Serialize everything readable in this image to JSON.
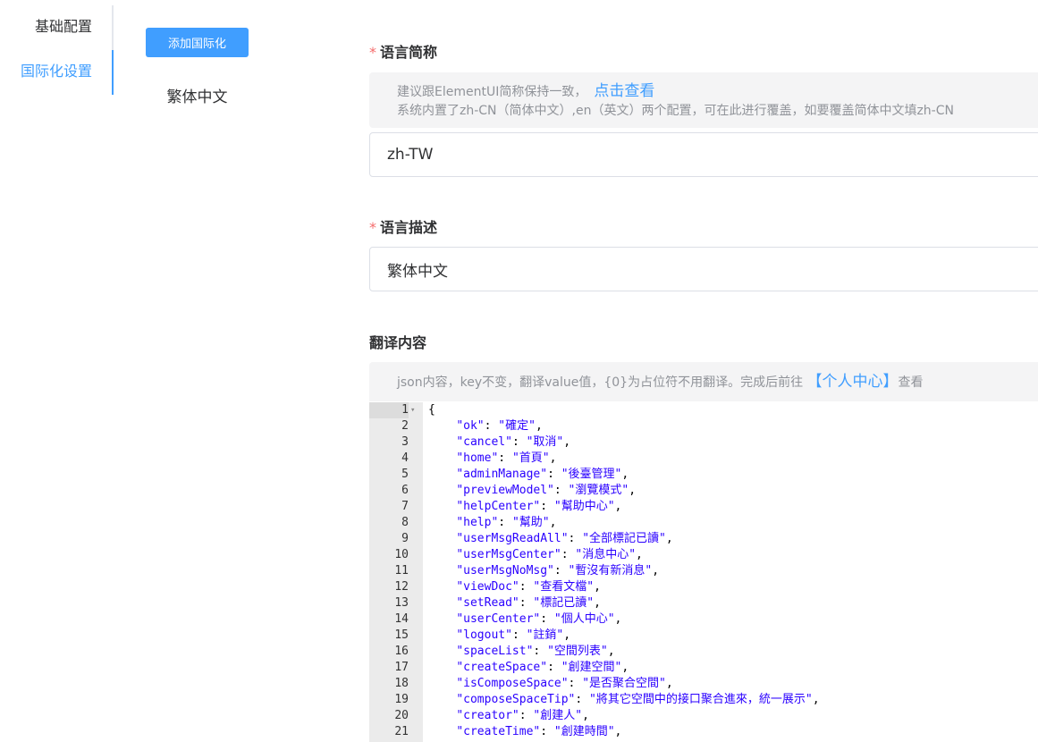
{
  "sidebar": {
    "tabs": [
      {
        "label": "基础配置"
      },
      {
        "label": "国际化设置"
      }
    ]
  },
  "lang_list": {
    "add_button": "添加国际化",
    "items": [
      {
        "label": "繁体中文"
      }
    ]
  },
  "form": {
    "short_name": {
      "label": "语言简称",
      "tip_line1": "建议跟ElementUI简称保持一致，",
      "tip_link": "点击查看",
      "tip_line2": "系统内置了zh-CN（简体中文）,en（英文）两个配置，可在此进行覆盖，如要覆盖简体中文填zh-CN",
      "value": "zh-TW"
    },
    "description": {
      "label": "语言描述",
      "value": "繁体中文"
    },
    "translation": {
      "label": "翻译内容",
      "tip_prefix": "json内容，key不变，翻译value值，{0}为占位符不用翻译。完成后前往 ",
      "tip_link": "【个人中心】",
      "tip_suffix": "查看"
    }
  },
  "editor": {
    "lines": [
      {
        "n": "1",
        "text": "{"
      },
      {
        "n": "2",
        "text": "    \"ok\": \"確定\","
      },
      {
        "n": "3",
        "text": "    \"cancel\": \"取消\","
      },
      {
        "n": "4",
        "text": "    \"home\": \"首頁\","
      },
      {
        "n": "5",
        "text": "    \"adminManage\": \"後臺管理\","
      },
      {
        "n": "6",
        "text": "    \"previewModel\": \"瀏覽模式\","
      },
      {
        "n": "7",
        "text": "    \"helpCenter\": \"幫助中心\","
      },
      {
        "n": "8",
        "text": "    \"help\": \"幫助\","
      },
      {
        "n": "9",
        "text": "    \"userMsgReadAll\": \"全部標記已讀\","
      },
      {
        "n": "10",
        "text": "    \"userMsgCenter\": \"消息中心\","
      },
      {
        "n": "11",
        "text": "    \"userMsgNoMsg\": \"暫沒有新消息\","
      },
      {
        "n": "12",
        "text": "    \"viewDoc\": \"查看文檔\","
      },
      {
        "n": "13",
        "text": "    \"setRead\": \"標記已讀\","
      },
      {
        "n": "14",
        "text": "    \"userCenter\": \"個人中心\","
      },
      {
        "n": "15",
        "text": "    \"logout\": \"註銷\","
      },
      {
        "n": "16",
        "text": "    \"spaceList\": \"空間列表\","
      },
      {
        "n": "17",
        "text": "    \"createSpace\": \"創建空間\","
      },
      {
        "n": "18",
        "text": "    \"isComposeSpace\": \"是否聚合空間\","
      },
      {
        "n": "19",
        "text": "    \"composeSpaceTip\": \"將其它空間中的接口聚合進來，統一展示\","
      },
      {
        "n": "20",
        "text": "    \"creator\": \"創建人\","
      },
      {
        "n": "21",
        "text": "    \"createTime\": \"創建時間\","
      }
    ]
  },
  "colors": {
    "accent": "#409EFF",
    "required": "#F56C6C",
    "tip_bg": "#f4f4f5"
  }
}
